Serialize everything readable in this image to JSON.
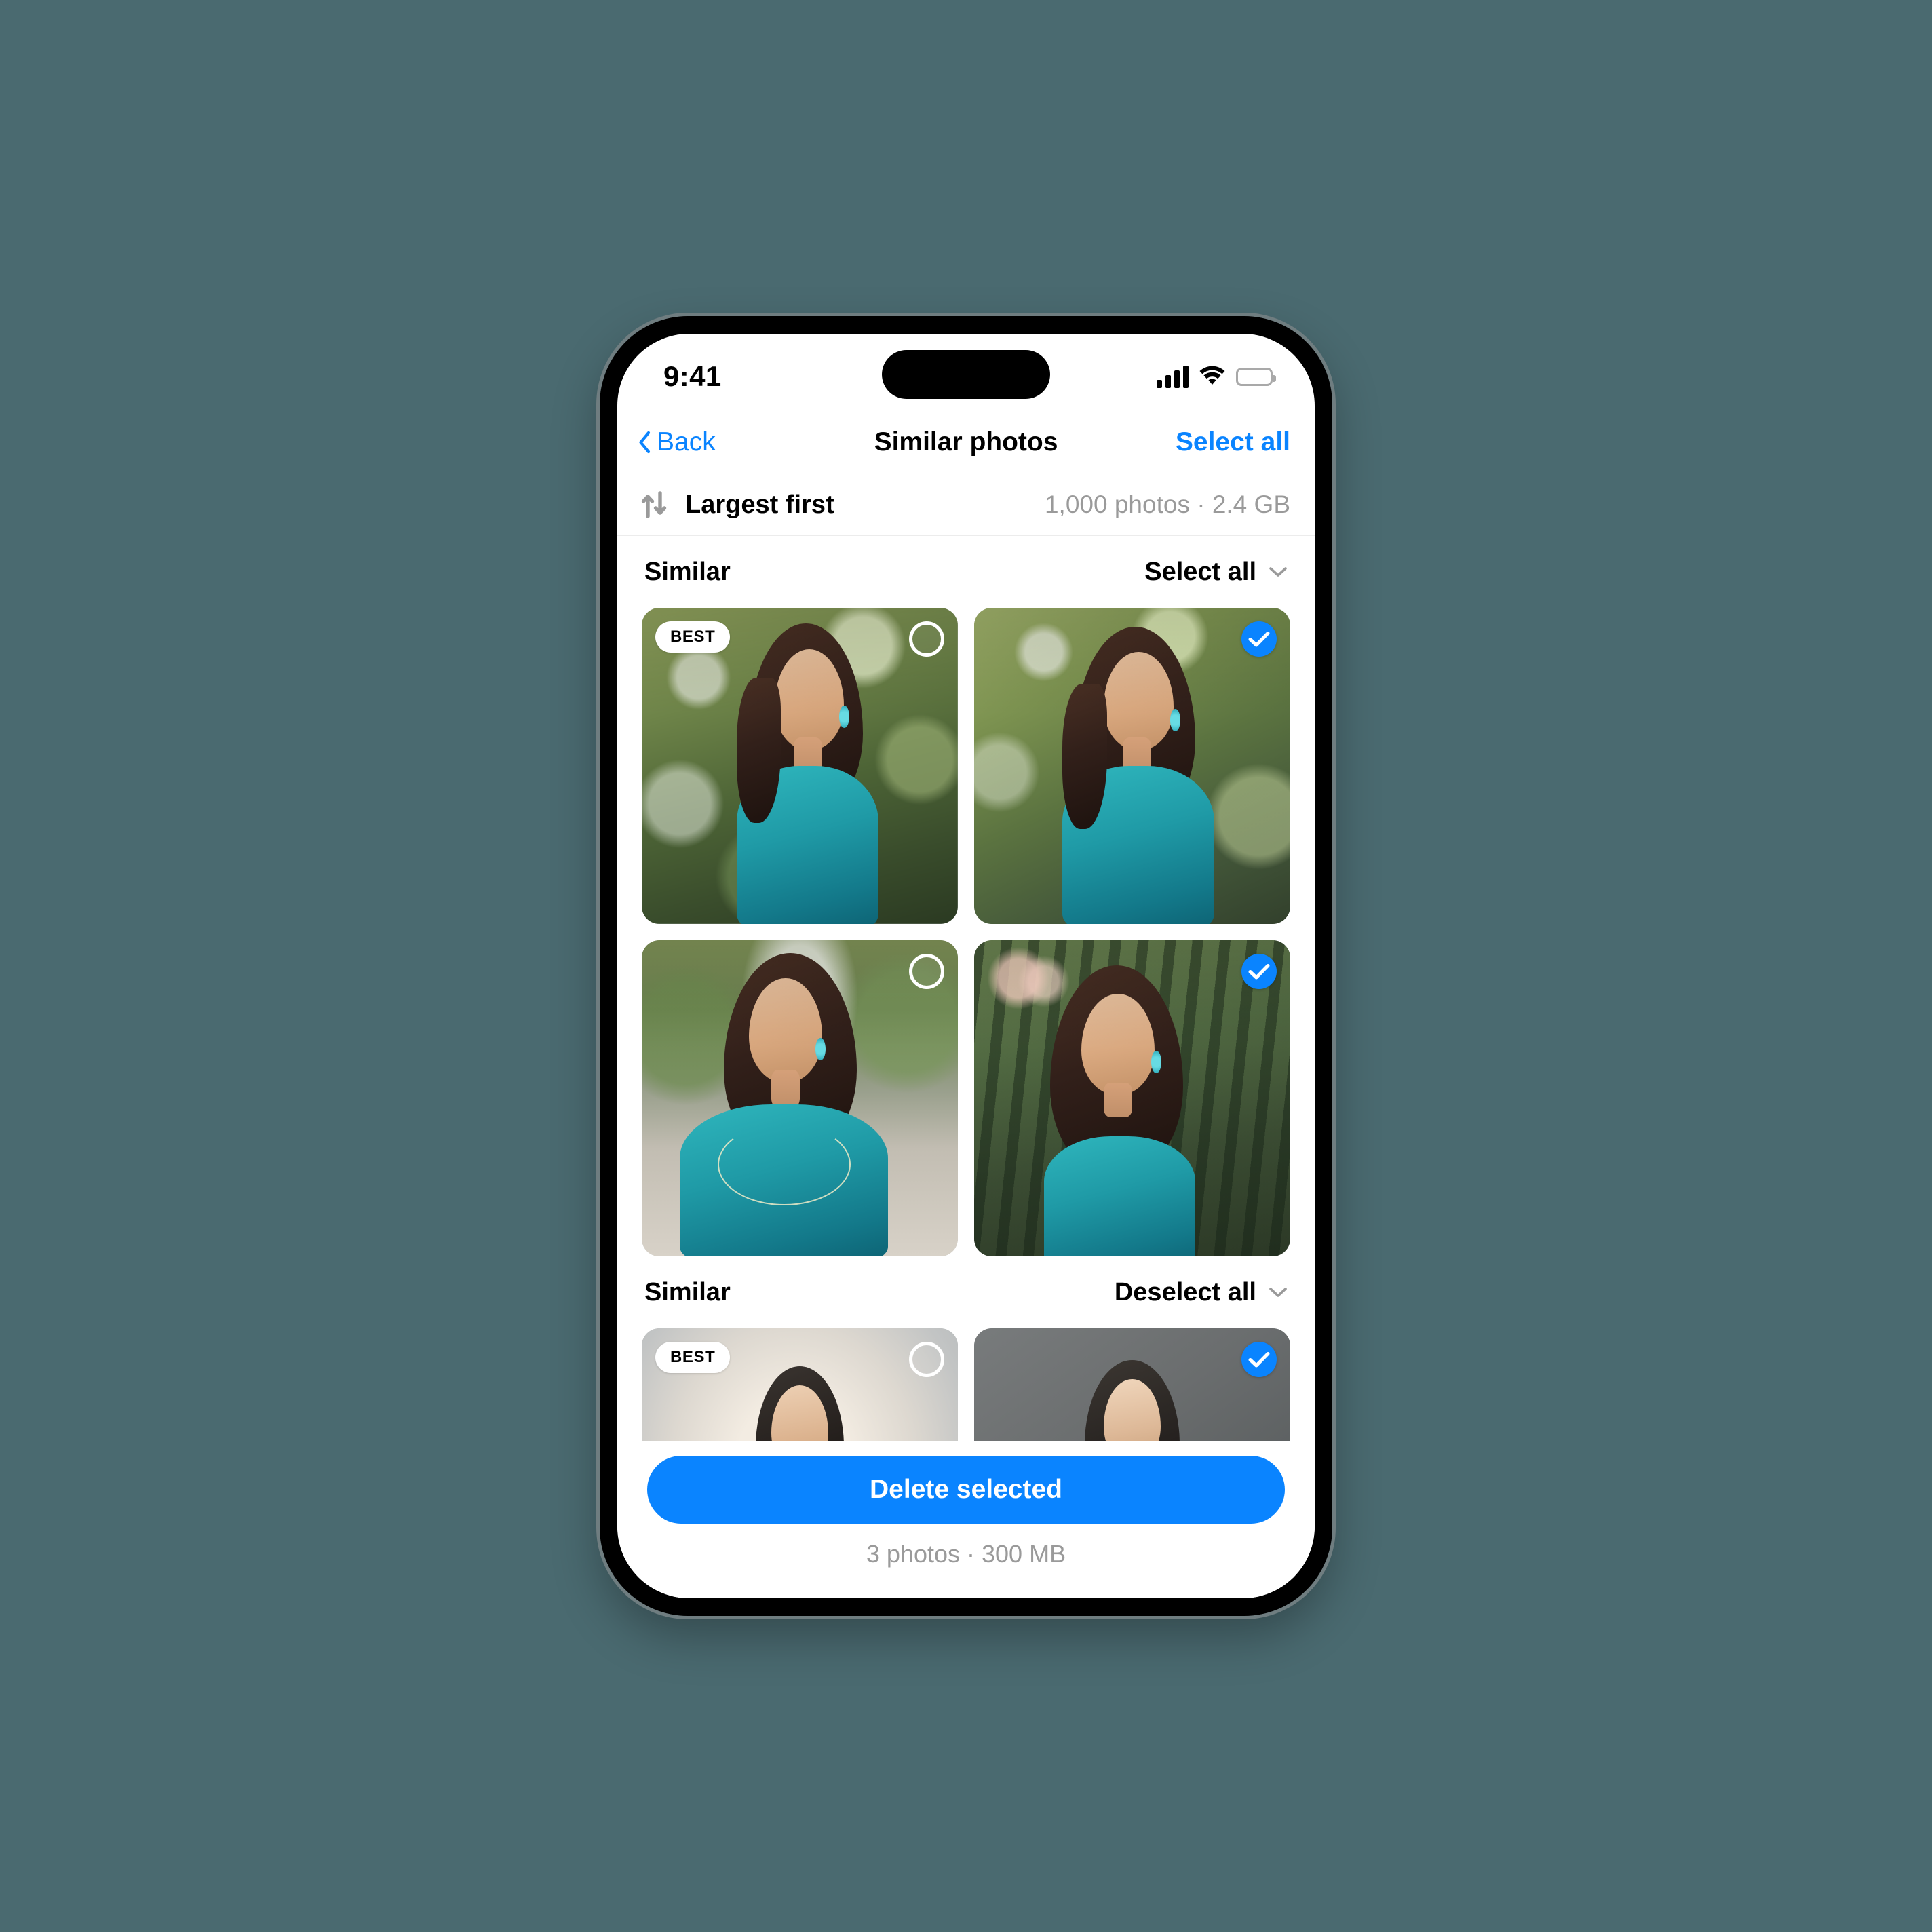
{
  "status_bar": {
    "time": "9:41",
    "signal_icon": "cellular-signal-icon",
    "wifi_icon": "wifi-icon",
    "battery_icon": "battery-full-icon"
  },
  "nav": {
    "back_label": "Back",
    "back_icon": "chevron-left-icon",
    "title": "Similar photos",
    "action_label": "Select all"
  },
  "sort": {
    "icon": "sort-arrows-icon",
    "label": "Largest first",
    "meta": "1,000 photos · 2.4 GB"
  },
  "sections": [
    {
      "title": "Similar",
      "action_label": "Select all",
      "action_icon": "chevron-down-icon",
      "photos": [
        {
          "art": "bg-garden",
          "badge": "BEST",
          "selected": false,
          "subject": "woman-teal-halter-dress"
        },
        {
          "art": "bg-garden2",
          "badge": null,
          "selected": true,
          "subject": "woman-teal-vneck-dress"
        },
        {
          "art": "bg-street",
          "badge": null,
          "selected": false,
          "subject": "woman-teal-beaded-dress"
        },
        {
          "art": "bg-forest",
          "badge": null,
          "selected": true,
          "subject": "woman-teal-strap-dress"
        }
      ]
    },
    {
      "title": "Similar",
      "action_label": "Deselect all",
      "action_icon": "chevron-down-icon",
      "photos": [
        {
          "art": "bg-studio-light",
          "badge": "BEST",
          "selected": false,
          "subject": "woman-white-sweatshirt-light"
        },
        {
          "art": "bg-studio-dark",
          "badge": null,
          "selected": true,
          "subject": "woman-white-sweatshirt-dark"
        }
      ]
    }
  ],
  "bottom": {
    "delete_label": "Delete selected",
    "meta": "3 photos · 300 MB"
  },
  "colors": {
    "accent_blue": "#0a84ff",
    "page_background": "#4a6a70",
    "muted_text": "#9a9a9a",
    "screen_background": "#ffffff"
  }
}
